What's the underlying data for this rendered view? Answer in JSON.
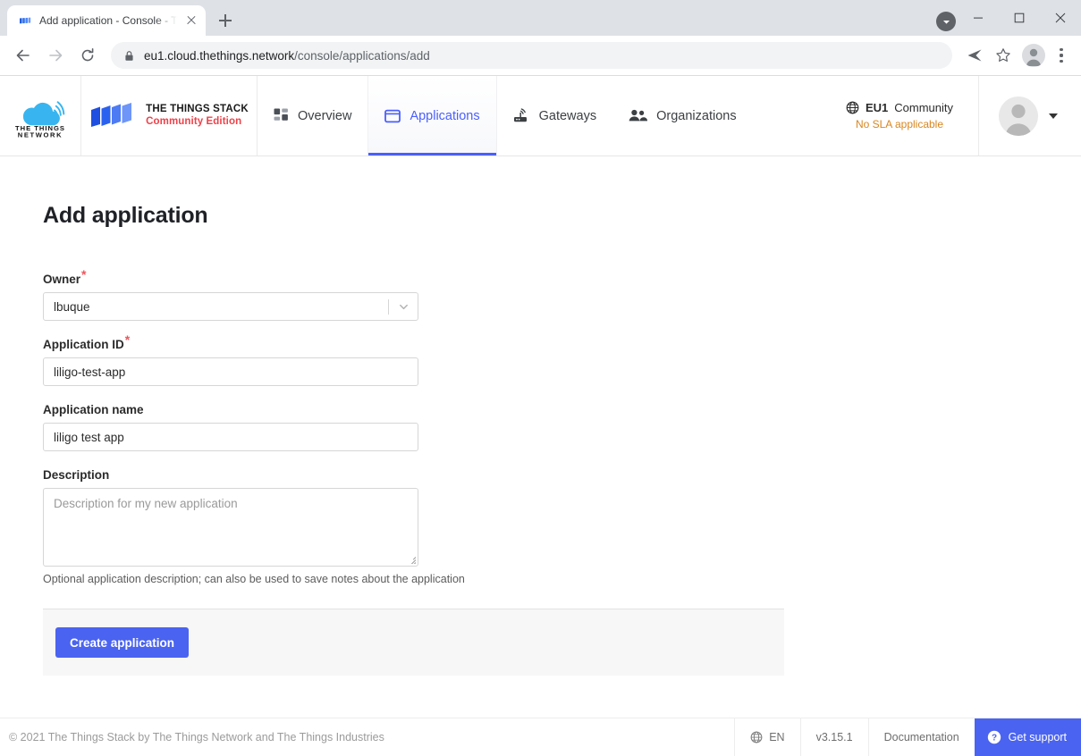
{
  "browser": {
    "tab_title": "Add application - Console - Th",
    "tab_favicon_icon": "ttn-stack-favicon",
    "new_tab_label": "+",
    "back_icon": "arrow-left-icon",
    "forward_icon": "arrow-right-icon",
    "reload_icon": "reload-icon",
    "lock_icon": "lock-icon",
    "url_host": "eu1.cloud.thethings.network",
    "url_path": "/console/applications/add",
    "share_icon": "send-icon",
    "bookmark_icon": "star-icon",
    "profile_icon": "account-avatar-icon",
    "menu_icon": "three-dot-menu-icon",
    "download_badge_icon": "download-arrow-icon",
    "minimize_icon": "minimize-icon",
    "maximize_icon": "maximize-icon",
    "close_icon": "close-icon"
  },
  "header": {
    "logo_alt": "THE THINGS NETWORK",
    "logo_line1": "THE THINGS",
    "logo_line2": "NETWORK",
    "brand_line1": "THE THINGS STACK",
    "brand_line2": "Community Edition",
    "nav": [
      {
        "label": "Overview",
        "icon": "grid-overview-icon",
        "active": false
      },
      {
        "label": "Applications",
        "icon": "application-window-icon",
        "active": true
      },
      {
        "label": "Gateways",
        "icon": "gateway-router-icon",
        "active": false
      },
      {
        "label": "Organizations",
        "icon": "people-group-icon",
        "active": false
      }
    ],
    "cluster_icon": "globe-icon",
    "cluster_name": "EU1",
    "cluster_type": "Community",
    "sla_text": "No SLA applicable",
    "avatar_icon": "user-avatar-icon",
    "user_caret_icon": "caret-down-icon"
  },
  "main": {
    "page_title": "Add application",
    "fields": {
      "owner": {
        "label": "Owner",
        "required_marker": "*",
        "value": "lbuque",
        "dropdown_icon": "chevron-down-icon"
      },
      "application_id": {
        "label": "Application ID",
        "required_marker": "*",
        "value": "liligo-test-app"
      },
      "application_name": {
        "label": "Application name",
        "value": "liligo test app"
      },
      "description": {
        "label": "Description",
        "placeholder": "Description for my new application",
        "value": "",
        "hint": "Optional application description; can also be used to save notes about the application"
      }
    },
    "submit_button": "Create application"
  },
  "footer": {
    "copyright": "© 2021 The Things Stack by The Things Network and The Things Industries",
    "language_icon": "globe-icon",
    "language": "EN",
    "version": "v3.15.1",
    "documentation": "Documentation",
    "support_icon": "question-circle-icon",
    "support": "Get support"
  },
  "colors": {
    "accent": "#4a63f0",
    "brand_red": "#ef4149",
    "sla_orange": "#d9861f",
    "required_red": "#f0545c",
    "ttn_blue": "#38b5f0"
  }
}
